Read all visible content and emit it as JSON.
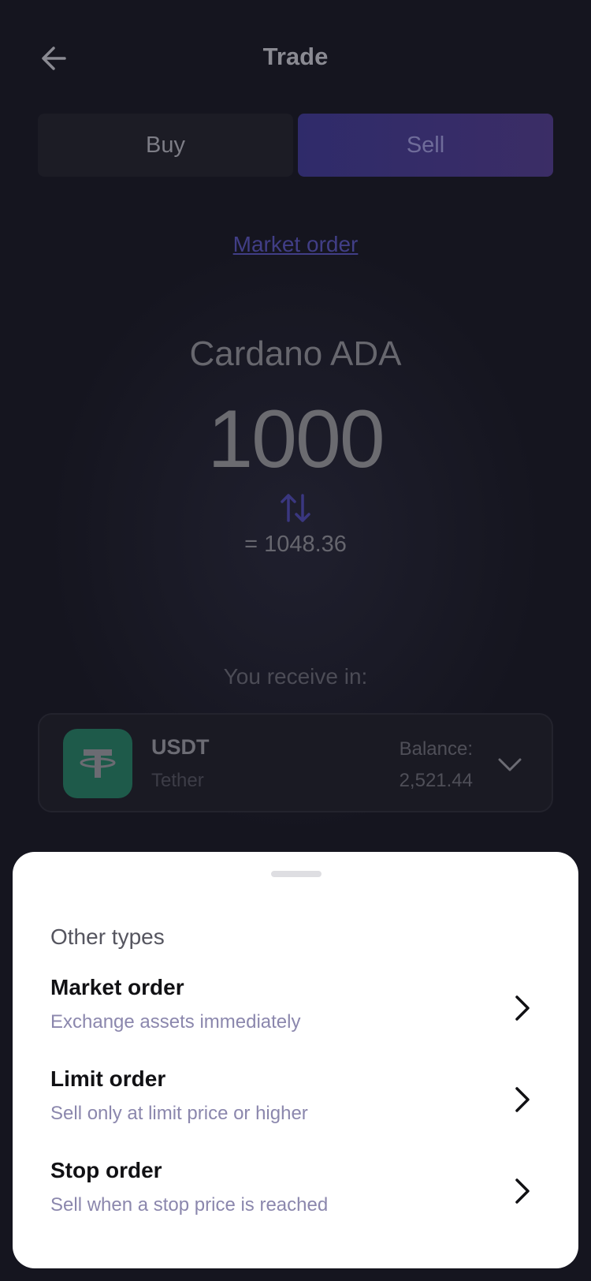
{
  "header": {
    "title": "Trade",
    "back_icon": "arrow-left-icon"
  },
  "tabs": [
    {
      "label": "Buy",
      "selected": false
    },
    {
      "label": "Sell",
      "selected": true
    }
  ],
  "order_type_link": "Market order",
  "asset": {
    "name": "Cardano ADA",
    "amount": "1000",
    "converted": "= 1048.36"
  },
  "receive": {
    "label": "You receive in:",
    "symbol": "USDT",
    "name": "Tether",
    "balance_label": "Balance:",
    "balance_value": "2,521.44"
  },
  "sheet": {
    "heading": "Other types",
    "options": [
      {
        "title": "Market order",
        "description": "Exchange assets immediately"
      },
      {
        "title": "Limit order",
        "description": "Sell only at limit price or higher"
      },
      {
        "title": "Stop order",
        "description": "Sell when a stop price is reached"
      }
    ]
  },
  "colors": {
    "accent": "#3b2d66",
    "link": "#413e86",
    "tether": "#1e5a4a"
  }
}
